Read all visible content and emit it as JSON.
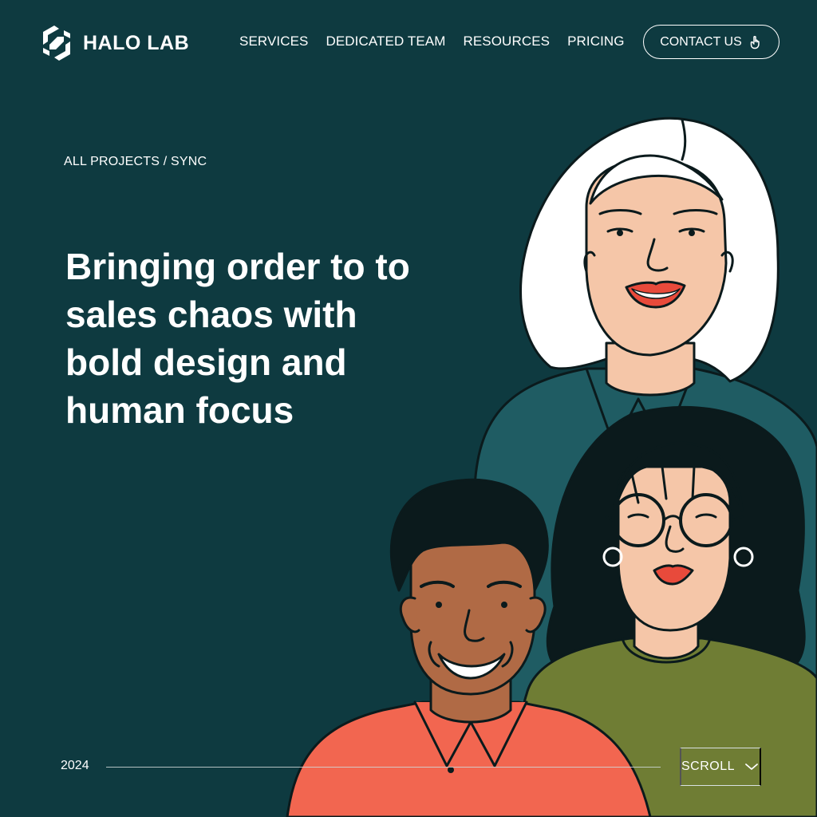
{
  "brand": {
    "name": "HALO LAB",
    "logo_icon": "halo-lab-logo-icon"
  },
  "nav": {
    "items": [
      {
        "label": "SERVICES"
      },
      {
        "label": "DEDICATED TEAM"
      },
      {
        "label": "RESOURCES"
      },
      {
        "label": "PRICING"
      }
    ],
    "contact": {
      "label": "CONTACT US",
      "icon": "pointer-hand-icon"
    }
  },
  "hero": {
    "breadcrumb": "ALL PROJECTS / SYNC",
    "headline": "Bringing order to to sales chaos with bold design and human focus"
  },
  "footer": {
    "year": "2024",
    "scroll": {
      "label": "SCROLL",
      "icon": "chevron-down-icon"
    }
  },
  "colors": {
    "background": "#0e3a40",
    "text": "#ffffff",
    "teal_sweater": "#1f5c63",
    "olive_sweater": "#6f7d34",
    "coral_shirt": "#f26650",
    "lip_red": "#e84a3b"
  }
}
